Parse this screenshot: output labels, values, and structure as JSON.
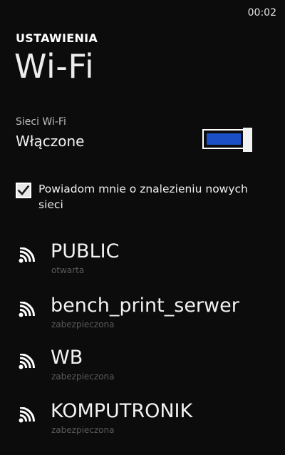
{
  "status_bar": {
    "time": "00:02"
  },
  "header": {
    "caption": "USTAWIENIA",
    "title": "Wi-Fi"
  },
  "wifi_toggle": {
    "label": "Sieci Wi-Fi",
    "state": "Włączone",
    "on": true,
    "accent_color": "#1a4fc6"
  },
  "notify": {
    "checked": true,
    "label": "Powiadom mnie o znalezieniu nowych sieci"
  },
  "networks": [
    {
      "name": "PUBLIC",
      "status": "otwarta",
      "icon": "wifi-signal-icon"
    },
    {
      "name": "bench_print_serwer",
      "status": "zabezpieczona",
      "icon": "wifi-signal-icon"
    },
    {
      "name": "WB",
      "status": "zabezpieczona",
      "icon": "wifi-signal-icon"
    },
    {
      "name": "KOMPUTRONIK",
      "status": "zabezpieczona",
      "icon": "wifi-signal-icon"
    }
  ]
}
